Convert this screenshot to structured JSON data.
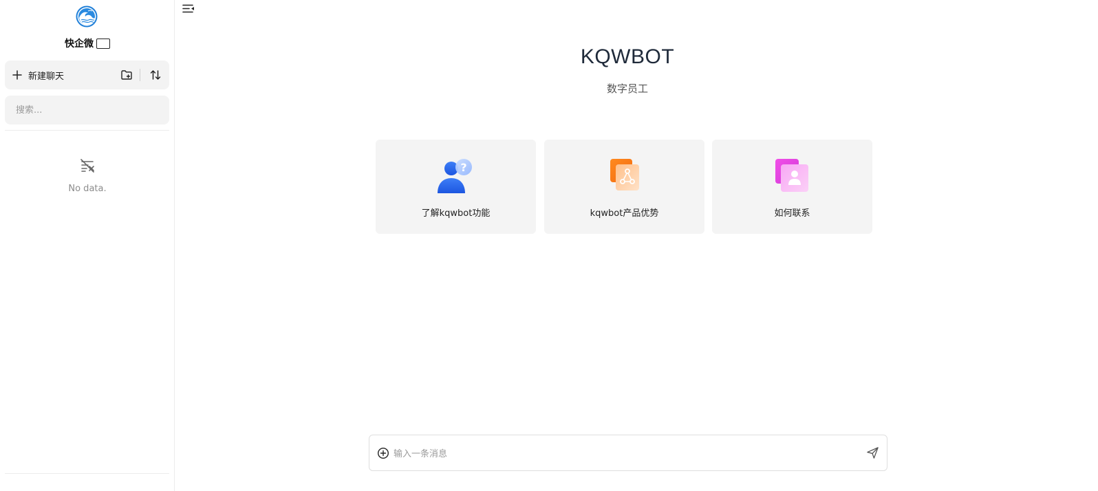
{
  "sidebar": {
    "logo_icon": "wave-logo-icon",
    "brand_name": "快企微",
    "new_chat_label": "新建聊天",
    "new_folder_icon": "folder-add-icon",
    "sort_icon": "sort-arrows-icon",
    "search_placeholder": "搜索...",
    "empty_icon": "no-data-icon",
    "empty_text": "No data."
  },
  "header": {
    "toggle_icon": "collapse-sidebar-icon"
  },
  "main": {
    "title": "KQWBOT",
    "subtitle": "数字员工",
    "cards": [
      {
        "label": "了解kqwbot功能",
        "icon": "user-question-icon",
        "color": "#2f6bf2"
      },
      {
        "label": "kqwbot产品优势",
        "icon": "share-nodes-icon",
        "color": "#f5892a"
      },
      {
        "label": "如何联系",
        "icon": "contact-user-icon",
        "color": "#e35cf0"
      }
    ]
  },
  "composer": {
    "attach_icon": "plus-circle-icon",
    "placeholder": "输入一条消息",
    "send_icon": "send-icon"
  },
  "colors": {
    "panel_bg": "#f3f3f3",
    "title_color": "#1f2a3a",
    "logo_blue": "#1f7fd8"
  }
}
